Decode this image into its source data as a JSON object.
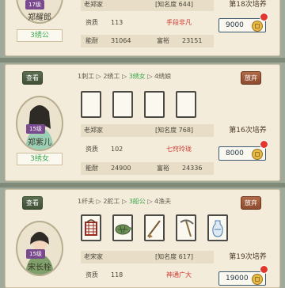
{
  "colors": {
    "accent_green": "#3ea84e",
    "accent_red": "#d03a30",
    "level_purple": "#7a4a8e"
  },
  "cards": [
    {
      "level": "17级",
      "name": "郑耀郎",
      "role": "3绣公",
      "family": "老郑家",
      "fame": "[知名度 644]",
      "aptitude_label": "资质",
      "aptitude": "113",
      "talent": "手段非凡",
      "ability_label": "能耐",
      "ability": "31064",
      "wealth_label": "富裕",
      "wealth": "23151",
      "train": "第18次培养",
      "cost": "9000"
    },
    {
      "view": "查看",
      "discard": "放弃",
      "path": {
        "s1": "1刺工",
        "s2": "2绣工",
        "s3": "3绣女",
        "s4": "4绣娘"
      },
      "level": "15级",
      "name": "郑紫儿",
      "role": "3绣女",
      "family": "老郑家",
      "fame": "[知名度 768]",
      "aptitude_label": "资质",
      "aptitude": "102",
      "talent": "七窍玲珑",
      "ability_label": "能耐",
      "ability": "24900",
      "wealth_label": "富裕",
      "wealth": "24336",
      "train": "第16次培养",
      "cost": "8000"
    },
    {
      "view": "查看",
      "discard": "放弃",
      "path": {
        "s1": "1纤夫",
        "s2": "2舵工",
        "s3": "3船公",
        "s4": "4渔夫"
      },
      "level": "15级",
      "name": "宋长栓",
      "family": "老宋家",
      "fame": "[知名度 617]",
      "aptitude_label": "资质",
      "aptitude": "118",
      "talent": "神通广大",
      "train": "第19次培养",
      "cost": "19000"
    }
  ],
  "icons": [
    "basket-icon",
    "turtle-icon",
    "oar-icon",
    "pickaxe-icon",
    "vase-icon",
    "coin-icon"
  ]
}
